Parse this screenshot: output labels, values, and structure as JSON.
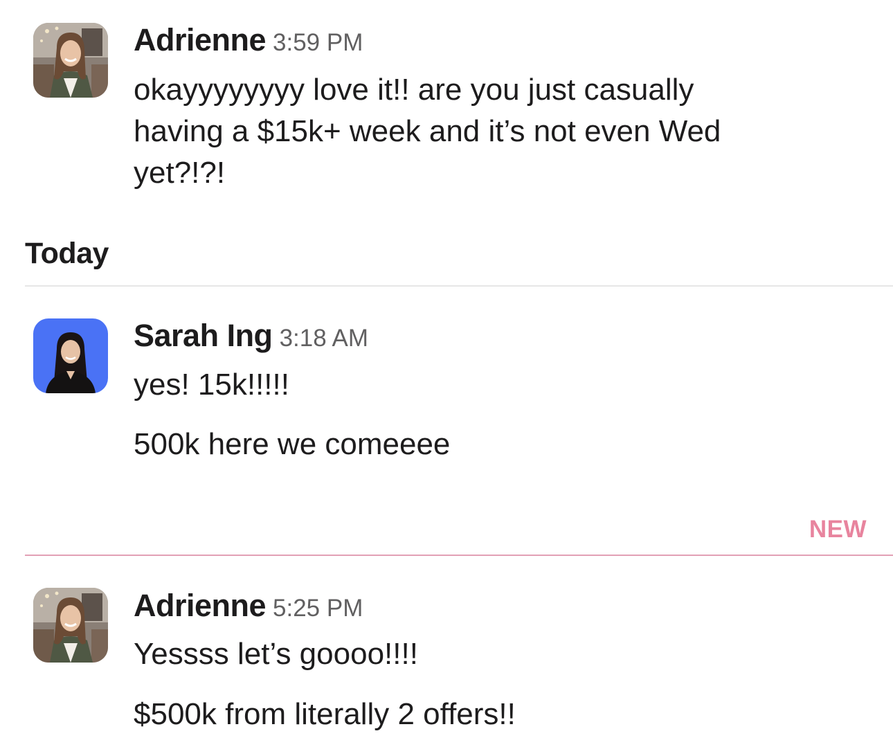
{
  "messages_top": {
    "author": "Adrienne",
    "time": "3:59 PM",
    "avatar_icon": "adrienne-avatar",
    "lines": [
      "okayyyyyyyy love it!! are you just casually",
      "having a $15k+ week and it’s not even Wed",
      "yet?!?!"
    ]
  },
  "divider_today": {
    "label": "Today"
  },
  "message_sarah": {
    "author": "Sarah Ing",
    "time": "3:18 AM",
    "avatar_icon": "sarah-avatar",
    "avatar_bg": "#4a72f5",
    "line1": "yes! 15k!!!!!",
    "line2": "500k here we comeeee"
  },
  "divider_new": {
    "label": "NEW",
    "color": "#e8849e"
  },
  "message_bottom": {
    "author": "Adrienne",
    "time": "5:25 PM",
    "avatar_icon": "adrienne-avatar",
    "line1": "Yessss let’s goooo!!!!",
    "line2": "$500k from literally 2 offers!!"
  }
}
